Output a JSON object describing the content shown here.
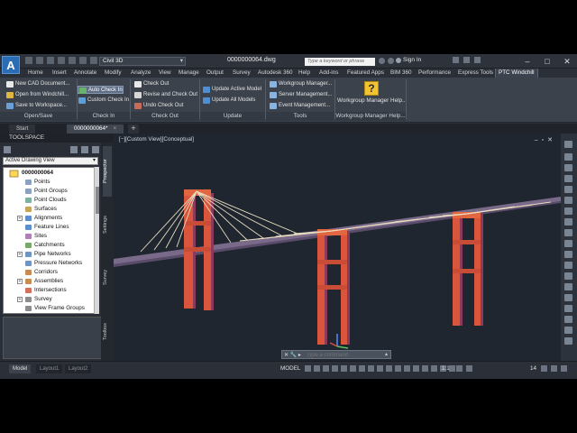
{
  "titlebar": {
    "app_letter": "A",
    "workspace": "Civil 3D",
    "document": "0000000064.dwg",
    "search_placeholder": "Type a keyword or phrase",
    "signin": "Sign In"
  },
  "tabs": [
    "Home",
    "Insert",
    "Annotate",
    "Modify",
    "Analyze",
    "View",
    "Manage",
    "Output",
    "Survey",
    "Autodesk 360",
    "Help",
    "Add-ins",
    "Featured Apps",
    "BIM 360",
    "Performance",
    "Express Tools",
    "PTC Windchill"
  ],
  "active_tab": "PTC Windchill",
  "ribbon": {
    "open_save": {
      "items": [
        "New CAD Document...",
        "Open from Windchill...",
        "Save to Workspace..."
      ],
      "label": "Open/Save"
    },
    "check_in": {
      "items": [
        "Auto Check In",
        "Custom Check In"
      ],
      "label": "Check In"
    },
    "check_out": {
      "items": [
        "Check Out",
        "Revise and Check Out",
        "Undo Check Out"
      ],
      "label": "Check Out"
    },
    "update": {
      "items": [
        "Update Active Model",
        "Update All Models"
      ],
      "label": "Update"
    },
    "tools": {
      "items": [
        "Workgroup Manager...",
        "Server Management...",
        "Event Management..."
      ],
      "label": "Tools"
    },
    "help": {
      "button": "Workgroup Manager Help...",
      "label": "Workgroup Manager Help..."
    }
  },
  "doc_tabs": {
    "start": "Start",
    "active": "0000000064*"
  },
  "toolspace": {
    "title": "TOOLSPACE",
    "view": "Active Drawing View",
    "root": "0000000064",
    "items": [
      "Points",
      "Point Groups",
      "Point Clouds",
      "Surfaces",
      "Alignments",
      "Feature Lines",
      "Sites",
      "Catchments",
      "Pipe Networks",
      "Pressure Networks",
      "Corridors",
      "Assemblies",
      "Intersections",
      "Survey",
      "View Frame Groups"
    ],
    "side_tabs": [
      "Prospector",
      "Settings",
      "Survey",
      "Toolbox"
    ]
  },
  "viewport": {
    "label": "[−][Custom View][Conceptual]",
    "command_placeholder": "Type a command"
  },
  "statusbar": {
    "layout_tabs": [
      "Model",
      "Layout1",
      "Layout2"
    ],
    "model": "MODEL",
    "scale": "1:1",
    "number": "14"
  },
  "colors": {
    "tower": "#d9553b",
    "tower_side": "#8c3a5c",
    "deck": "#7a6a8a",
    "cable": "#e8ddc0",
    "accent": "#2a6db5"
  }
}
